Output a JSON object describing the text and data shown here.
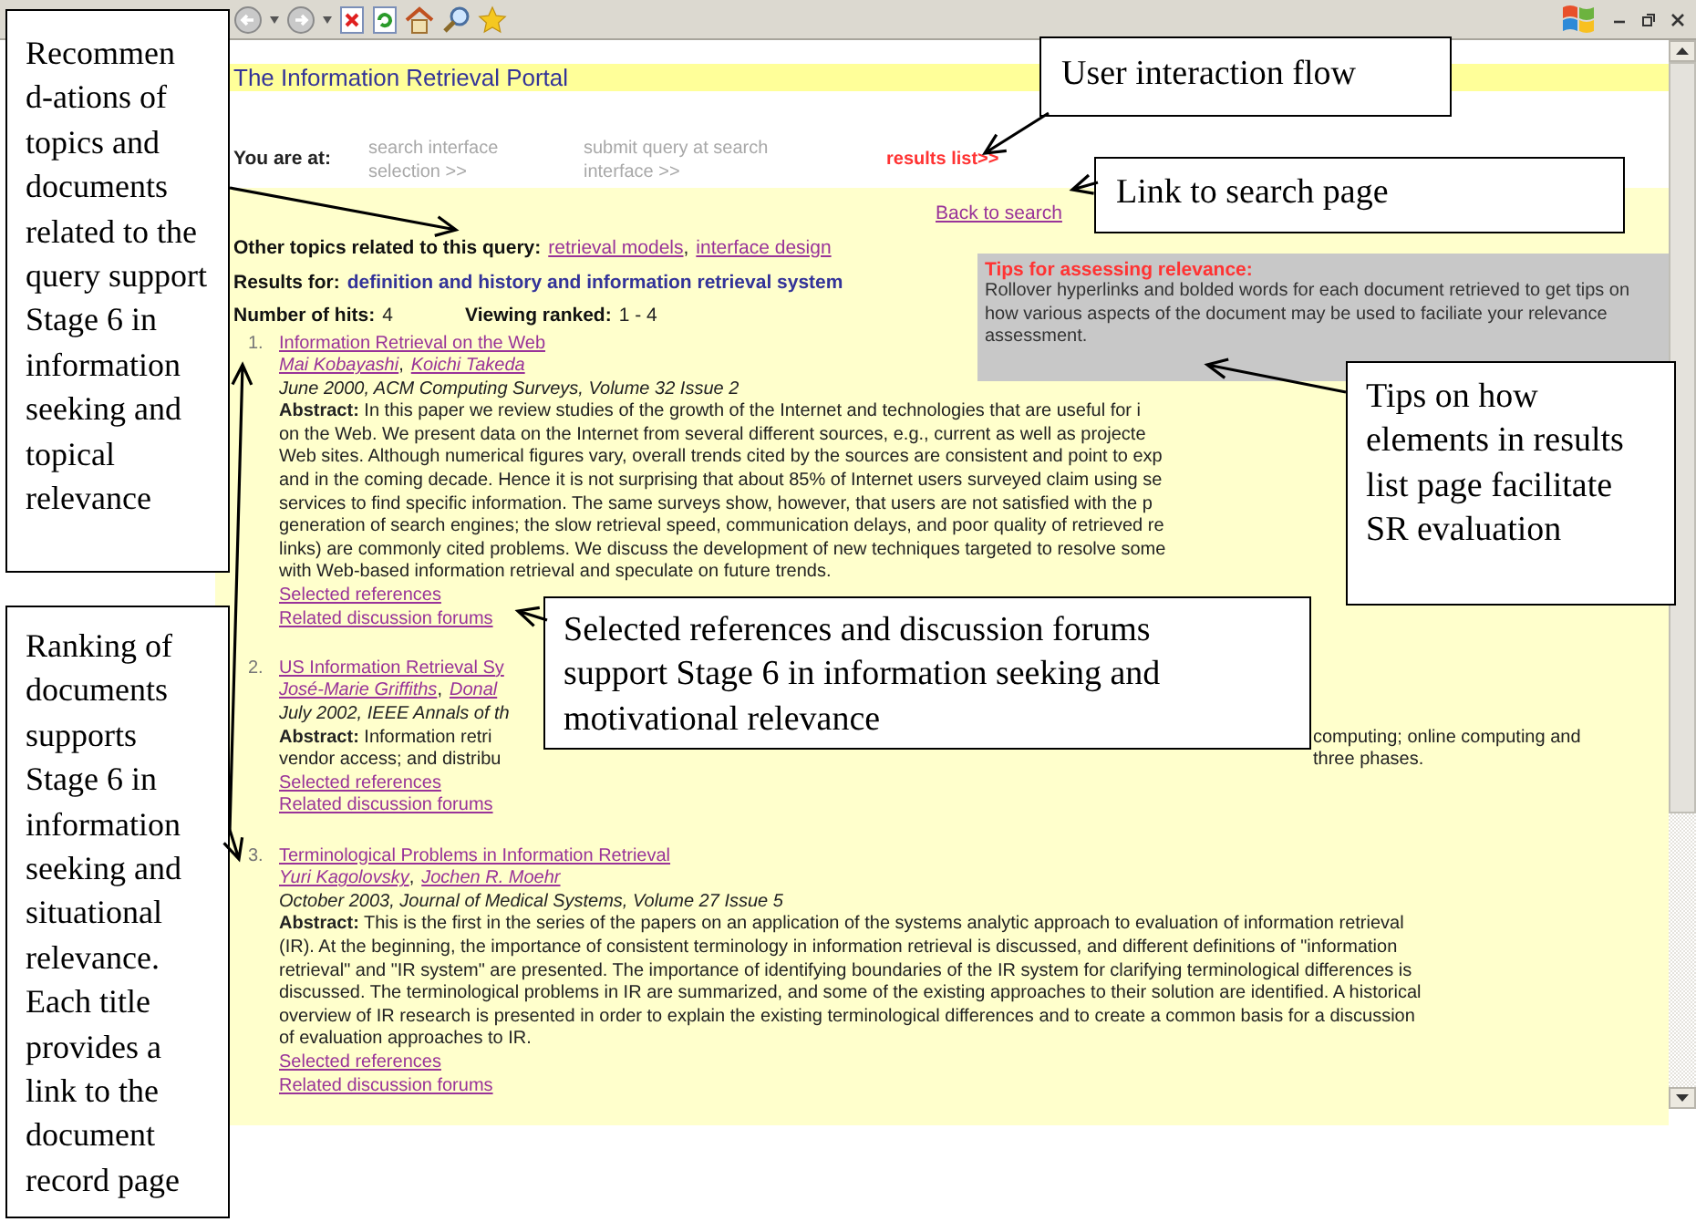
{
  "page": {
    "title": "The Information Retrieval Portal",
    "breadcrumb": {
      "label": "You are at:",
      "steps": [
        {
          "text": "search interface selection >>",
          "selected": false
        },
        {
          "text": "submit query at search interface >>",
          "selected": false
        },
        {
          "text": "results list>>",
          "selected": true
        }
      ]
    },
    "back_link": "Back to search",
    "related": {
      "label": "Other topics related to this query:",
      "links": [
        "retrieval models",
        "interface design"
      ],
      "separator": ","
    },
    "results_for": {
      "label": "Results for:",
      "query": "definition and history and information retrieval system"
    },
    "hits": {
      "label": "Number of hits:",
      "value": "4"
    },
    "viewing": {
      "label": "Viewing ranked:",
      "value": "1 - 4"
    },
    "tips": {
      "title": "Tips for assessing relevance:",
      "text": "Rollover hyperlinks and bolded words for each document retrieved to get tips on how various aspects of the document may be used to faciliate your relevance assessment."
    },
    "results": [
      {
        "number": "1.",
        "title": "Information Retrieval on the Web",
        "authors": [
          "Mai Kobayashi",
          "Koichi Takeda"
        ],
        "author_separator": ",",
        "meta": "June 2000, ACM Computing Surveys, Volume 32 Issue 2",
        "lines": [
          {
            "text": "**Abstract:** In this paper we review studies of the growth of the Internet and technologies that are useful for i"
          },
          {
            "text": "on the Web. We present data on the Internet from several different sources, e.g., current as well as projecte"
          },
          {
            "text": "Web sites. Although numerical figures vary, overall trends cited by the sources are consistent and point to exp"
          },
          {
            "text": "and in the coming decade. Hence it is not surprising that about 85% of Internet users surveyed claim using se"
          },
          {
            "text": "services to find specific information. The same surveys show, however, that users are not satisfied with the p"
          },
          {
            "text": "generation of search engines; the slow retrieval speed, communication delays, and poor quality of retrieved re"
          },
          {
            "text": "links) are commonly cited problems. We discuss the development of new techniques targeted to resolve some"
          },
          {
            "text": "with Web-based information retrieval and speculate on future trends."
          }
        ],
        "links": [
          "Selected references",
          "Related discussion forums"
        ]
      },
      {
        "number": "2.",
        "title": "US Information Retrieval Sy",
        "authors": [
          "José-Marie Griffiths",
          "Donal"
        ],
        "author_separator": ",",
        "meta": "July 2002, IEEE Annals of th",
        "lines": [
          {
            "text": "**Abstract:** Information retri",
            "continued": "computing; online computing and"
          },
          {
            "text": "vendor access; and distribu",
            "continued": "three phases."
          }
        ],
        "links": [
          "Selected references",
          "Related discussion forums"
        ]
      },
      {
        "number": "3.",
        "title": "Terminological Problems in Information Retrieval",
        "authors": [
          "Yuri Kagolovsky",
          "Jochen R. Moehr"
        ],
        "author_separator": ",",
        "meta": "October 2003, Journal of Medical Systems, Volume 27 Issue 5",
        "lines": [
          {
            "text": "**Abstract:** This is the first in the series of the papers on an application of the systems analytic approach to evaluation of information retrieval"
          },
          {
            "text": "(IR). At the beginning, the importance of consistent terminology in information retrieval is discussed, and different definitions of \"information"
          },
          {
            "text": "retrieval\" and \"IR system\" are presented. The importance of identifying boundaries of the IR system for clarifying terminological differences is"
          },
          {
            "text": "discussed. The terminological problems in IR are summarized, and some of the existing approaches to their solution are identified. A historical"
          },
          {
            "text": "overview of IR research is presented in order to explain the existing terminological differences and to create a common basis for a discussion"
          },
          {
            "text": "of evaluation approaches to IR."
          }
        ],
        "links": [
          "Selected references",
          "Related discussion forums"
        ]
      }
    ]
  },
  "callouts": [
    {
      "text": "Recommen d-ations of topics and documents related to the query support Stage 6 in information seeking and topical relevance"
    },
    {
      "text": "Ranking of documents supports Stage 6 in information seeking and situational relevance. Each title provides a link to the document record page"
    },
    {
      "text": "User interaction flow"
    },
    {
      "text": "Link to search page"
    },
    {
      "text": "Tips on how elements in results list page facilitate SR evaluation"
    },
    {
      "text": "Selected references and discussion forums support Stage 6 in information seeking and motivational relevance"
    }
  ]
}
